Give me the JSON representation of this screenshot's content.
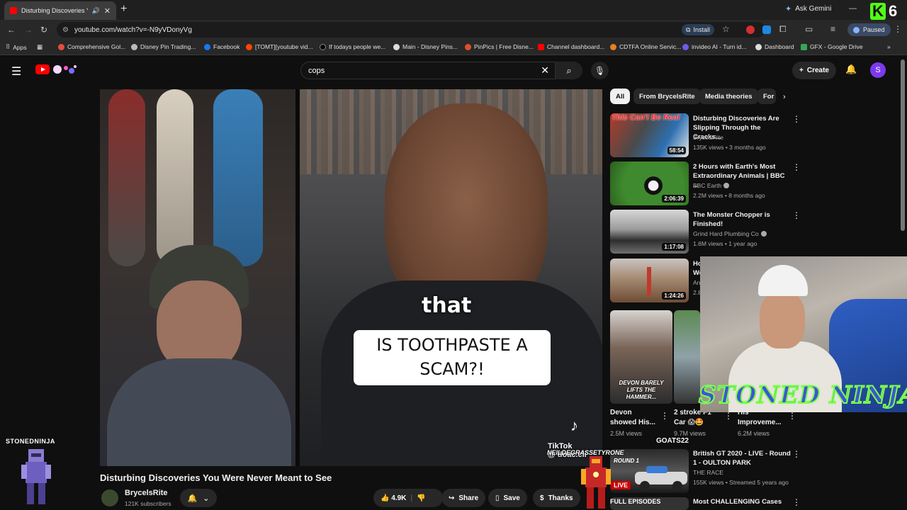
{
  "browser": {
    "tab_title": "Disturbing Discoveries You",
    "url": "youtube.com/watch?v=-N9yVDonyVg",
    "install_label": "Install",
    "ask_gemini_label": "Ask Gemini",
    "paused_label": "Paused",
    "bookmarks": [
      {
        "label": "Apps",
        "color": "#8ab4f8"
      },
      {
        "label": "Comprehensive Gol...",
        "color": "#e74c3c"
      },
      {
        "label": "Disney Pin Trading...",
        "color": "#bbbbbb"
      },
      {
        "label": "Facebook",
        "color": "#1877f2"
      },
      {
        "label": "[TOMT][youtube vid...",
        "color": "#ff4500"
      },
      {
        "label": "If todays people we...",
        "color": "#111111"
      },
      {
        "label": "Main - Disney Pins...",
        "color": "#dddddd"
      },
      {
        "label": "PinPics | Free Disne...",
        "color": "#e04e2a"
      },
      {
        "label": "Channel dashboard...",
        "color": "#ff0000"
      },
      {
        "label": "CDTFA Online Servic...",
        "color": "#e67e22"
      },
      {
        "label": "invideo AI - Turn id...",
        "color": "#6c5ce7"
      },
      {
        "label": "Dashboard",
        "color": "#dddddd"
      },
      {
        "label": "GFX - Google Drive",
        "color": "#34a853"
      }
    ]
  },
  "youtube": {
    "search_query": "cops",
    "create_label": "Create",
    "avatar_letter": "S"
  },
  "player": {
    "caption_word": "that",
    "caption_box": "IS TOOTHPASTE A SCAM?!",
    "tiktok_label": "TikTok",
    "tiktok_handle": "@ doac.cli"
  },
  "video": {
    "title": "Disturbing Discoveries You Were Never Meant to See",
    "channel": "BrycelsRite",
    "subscribers": "121K subscribers",
    "likes": "4.9K",
    "share_label": "Share",
    "save_label": "Save",
    "thanks_label": "Thanks"
  },
  "chips": [
    {
      "label": "All",
      "active": true
    },
    {
      "label": "From BrycelsRite"
    },
    {
      "label": "Media theories"
    },
    {
      "label": "For"
    }
  ],
  "recommendations": [
    {
      "title": "Disturbing Discoveries Are Slipping Through the Cracks...",
      "channel": "BrycelsRite",
      "verified": false,
      "meta": "135K views • 3 months ago",
      "duration": "58:54",
      "overlay": "This Can't Be Real"
    },
    {
      "title": "2 Hours with Earth's Most Extraordinary Animals | BBC ...",
      "channel": "BBC Earth",
      "verified": true,
      "meta": "2.2M views • 8 months ago",
      "duration": "2:06:39"
    },
    {
      "title": "The Monster Chopper is Finished!",
      "channel": "Grind Hard Plumbing Co",
      "verified": true,
      "meta": "1.6M views • 1 year ago",
      "duration": "1:17:08"
    },
    {
      "title": "Ho... Wo...",
      "channel": "Ani",
      "meta": "2.8",
      "duration": "1:24:26"
    }
  ],
  "shorts": [
    {
      "title": "Devon showed His...",
      "views": "2.5M views",
      "overlay": "DEVON BARELY LIFTS THE HAMMER..."
    },
    {
      "title": "2 stroke F1 Car 😱🤩",
      "views": "9.7M views"
    },
    {
      "title": "His Improveme...",
      "views": "6.2M views"
    }
  ],
  "lower_recs": [
    {
      "title": "British GT 2020 - LIVE - Round 1 - OULTON PARK",
      "channel": "THE RACE",
      "meta": "155K views • Streamed 5 years ago"
    },
    {
      "title": "Most CHALLENGING Cases"
    }
  ],
  "overlays": {
    "stoned_ninja_banner": "STONED NINJA",
    "stoned_ninja_tag": "STONEDNINJA",
    "kick_number": "6",
    "goats_label": "GOATS22",
    "neil_label": "NEILDEGRASSETYRONE",
    "live_badge": "LIVE",
    "round_label": "ROUND 1",
    "full_episodes": "FULL EPISODES"
  }
}
